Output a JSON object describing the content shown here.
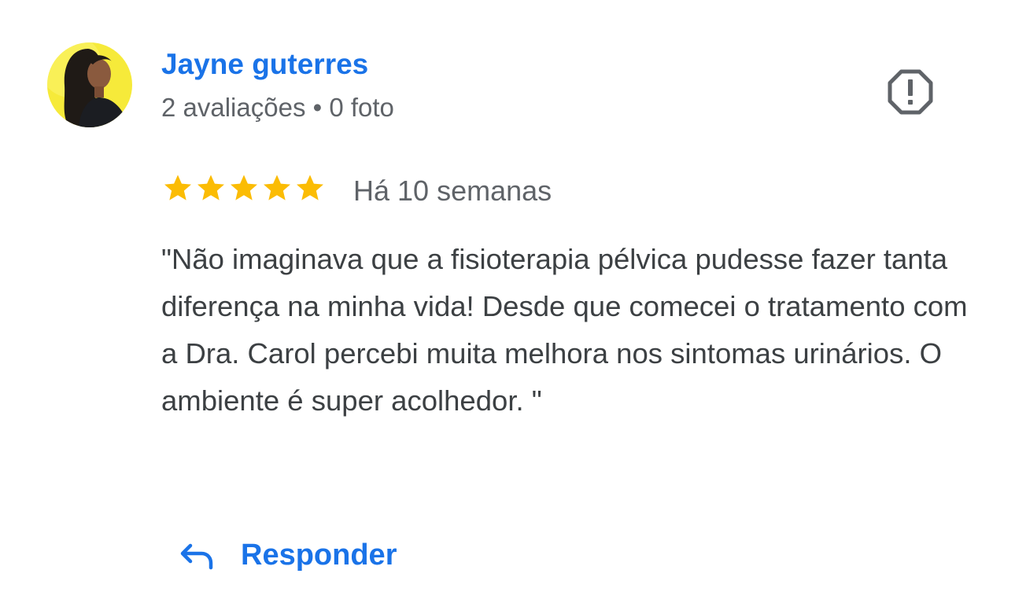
{
  "review": {
    "author": {
      "name": "Jayne guterres",
      "meta": "2 avaliações • 0 foto",
      "avatar_icon": "profile-photo"
    },
    "rating": {
      "value": 5,
      "max": 5,
      "star_color": "#fbbc04"
    },
    "date": "Há 10 semanas",
    "text": "\"Não imaginava que a fisioterapia pélvica pudesse fazer tanta diferença na minha vida! Desde que comecei o tratamento com a Dra. Carol percebi muita melhora nos sintomas urinários. O ambiente é super acolhedor. \"",
    "report_icon": "report-icon",
    "reply": {
      "label": "Responder",
      "icon": "reply-arrow-icon"
    }
  },
  "colors": {
    "accent": "#1a73e8",
    "text": "#3c4043",
    "secondary_text": "#5f6368",
    "icon_gray": "#5f6368"
  }
}
